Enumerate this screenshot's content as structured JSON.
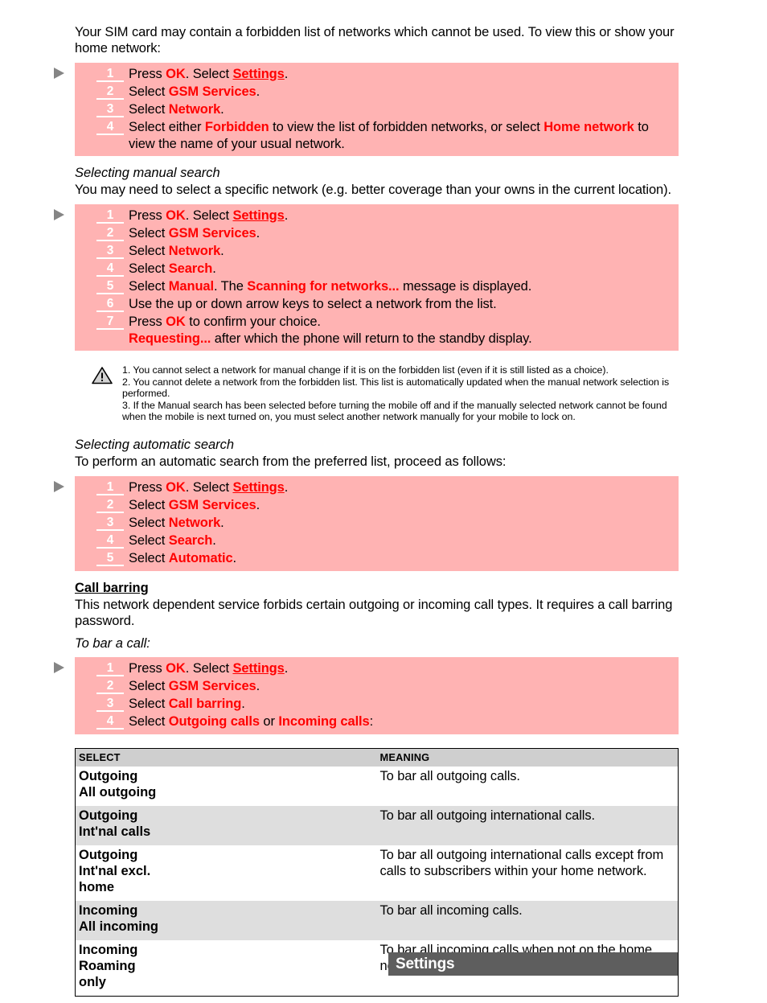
{
  "intro": {
    "text": "Your SIM card may contain a forbidden list of networks which cannot be used. To view this or show your home network:"
  },
  "procedures": [
    {
      "name": "forbidden-home-network",
      "steps": [
        {
          "num": "1",
          "html_key": "p1s1"
        },
        {
          "num": "2",
          "html_key": "p1s2"
        },
        {
          "num": "3",
          "html_key": "p1s3"
        },
        {
          "num": "4",
          "html_key": "p1s4"
        }
      ]
    }
  ],
  "steps_text": {
    "p1s1": "Press OK. Select Settings.",
    "p1s2": "Select GSM Services.",
    "p1s3": "Select Network.",
    "p1s4": "Select either Forbidden to view the list of forbidden networks, or select Home network to view the name of your usual network.",
    "p2s1": "Press OK. Select Settings.",
    "p2s2": "Select GSM Services.",
    "p2s3": "Select Network.",
    "p2s4": "Select Search.",
    "p2s5": "Select Manual. The Scanning for networks... message is displayed.",
    "p2s6": "Use the up or down arrow keys to select a network from the list.",
    "p2s7": "Press OK to confirm your choice.",
    "p2s7b": "Requesting... after which the phone will return to the standby display.",
    "p3s1": "Press OK. Select Settings.",
    "p3s2": "Select GSM Services.",
    "p3s3": "Select Network.",
    "p3s4": "Select Search.",
    "p3s5": "Select Automatic.",
    "p4s1": "Press OK. Select Settings.",
    "p4s2": "Select GSM Services.",
    "p4s3": "Select Call barring.",
    "p4s4": "Select Outgoing calls or Incoming calls:"
  },
  "manual_search": {
    "heading": "Selecting manual search",
    "body": "You may need to select a specific network (e.g. better coverage than your owns in the current location)."
  },
  "notes": {
    "item1": "1. You cannot select a network for manual change if it is on the forbidden list (even if it is still listed as a choice).",
    "item2": "2. You cannot delete a network from the forbidden list. This list is automatically updated when the manual network selection is performed.",
    "item3": "3. If the Manual search has been selected before turning the mobile off and if the manually selected network cannot be found when the mobile is next turned on, you must select another network manually for your mobile to lock on."
  },
  "automatic_search": {
    "heading": "Selecting automatic search",
    "body": "To perform an automatic search from the preferred list, proceed as follows:"
  },
  "call_barring": {
    "heading": "Call barring",
    "body": "This network dependent service forbids certain outgoing or incoming call types. It requires a call barring password.",
    "subheading": "To bar a call:"
  },
  "table": {
    "headers": [
      "SELECT",
      "MEANING"
    ],
    "rows": [
      {
        "select": "Outgoing\nAll outgoing",
        "meaning": "To bar all outgoing calls.",
        "shaded": false
      },
      {
        "select": "Outgoing\nInt'nal calls",
        "meaning": "To bar all outgoing international calls.",
        "shaded": true
      },
      {
        "select": "Outgoing\nInt'nal excl.\nhome",
        "meaning": "To bar all outgoing international calls except from calls to subscribers within your home network.",
        "shaded": false
      },
      {
        "select": "Incoming\nAll incoming",
        "meaning": "To bar all incoming calls.",
        "shaded": true
      },
      {
        "select": "Incoming\nRoaming\nonly",
        "meaning": "To bar all incoming calls when not on the home network.",
        "shaded": false
      }
    ]
  },
  "footer": {
    "label": "Settings"
  },
  "colors": {
    "procedure_background": "#ffb3b3",
    "accent_red": "#ff0000",
    "bullet_gray": "#858585",
    "table_header_gray": "#cfcfcf",
    "table_row_gray": "#dedede",
    "footer_gray": "#5e5e5e"
  },
  "icons": {
    "bullet": "triangle-right-icon",
    "warning": "warning-triangle-icon"
  }
}
